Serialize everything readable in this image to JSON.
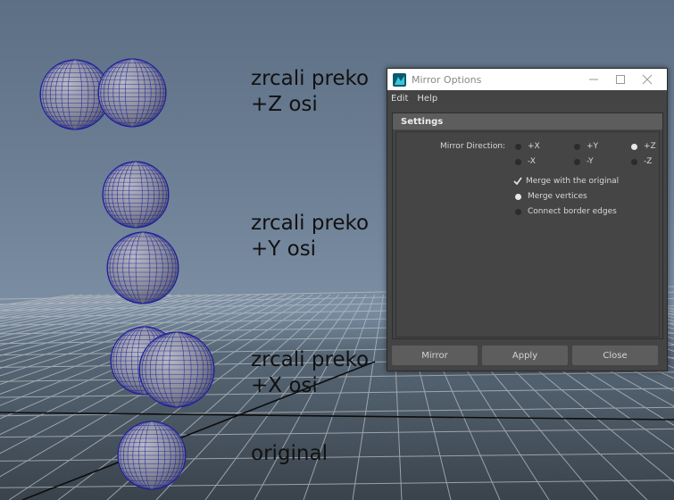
{
  "viewport": {
    "captions": {
      "z": "zrcali preko\n+Z osi",
      "y": "zrcali preko\n+Y osi",
      "x": "zrcali preko\n+X osi",
      "original": "original"
    },
    "colors": {
      "mesh_fill": "#8c8f9c",
      "wire": "#1c1e9c",
      "grid": "#c8ccd0",
      "axis": "#111111"
    }
  },
  "dialog": {
    "title": "Mirror Options",
    "menu": {
      "edit": "Edit",
      "help": "Help"
    },
    "section_title": "Settings",
    "mirror_direction": {
      "label": "Mirror Direction:",
      "options": [
        {
          "label": "+X",
          "selected": false
        },
        {
          "label": "+Y",
          "selected": false
        },
        {
          "label": "+Z",
          "selected": true
        },
        {
          "label": "-X",
          "selected": false
        },
        {
          "label": "-Y",
          "selected": false
        },
        {
          "label": "-Z",
          "selected": false
        }
      ]
    },
    "merge_with_original": {
      "label": "Merge with the original",
      "checked": true
    },
    "merge_vertices": {
      "label": "Merge vertices",
      "selected": true
    },
    "connect_border_edges": {
      "label": "Connect border edges",
      "selected": false
    },
    "buttons": {
      "mirror": "Mirror",
      "apply": "Apply",
      "close": "Close"
    },
    "icons": {
      "app": "maya-icon",
      "minimize": "minimize-icon",
      "maximize": "maximize-icon",
      "close": "close-icon"
    }
  }
}
